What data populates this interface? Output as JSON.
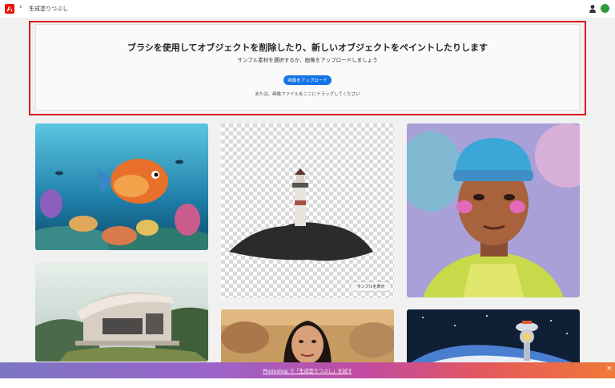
{
  "topbar": {
    "logo_icon": "adobe-logo-icon",
    "back_icon": "chevron-left-icon",
    "back_glyph": "‹",
    "breadcrumb": "生成塗りつぶし"
  },
  "upload": {
    "title": "ブラシを使用してオブジェクトを削除したり、新しいオブジェクトをペイントしたりします",
    "subtitle": "サンプル素材を選択するか、画像をアップロードしましょう",
    "button_label": "画像をアップロード",
    "drag_hint": "または、画像ファイルをここにドラッグしてください",
    "highlight_color": "#d7191c"
  },
  "gallery": {
    "sample_button": "サンプルを表示"
  },
  "banner": {
    "text": "Photoshop で「生成塗りつぶし」を試す",
    "close_glyph": "×"
  }
}
